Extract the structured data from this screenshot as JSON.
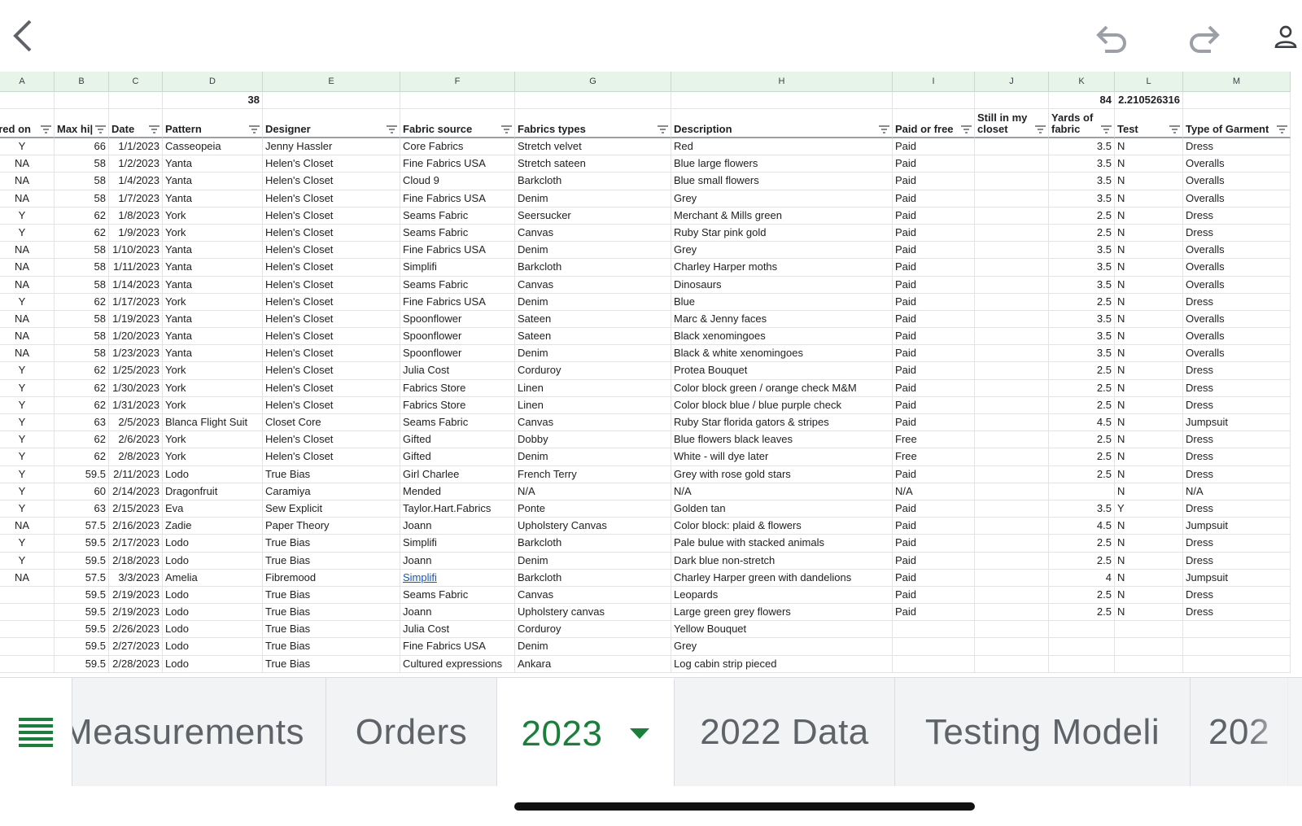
{
  "column_letters": [
    "A",
    "B",
    "C",
    "D",
    "E",
    "F",
    "G",
    "H",
    "I",
    "J",
    "K",
    "L",
    "M"
  ],
  "totals": {
    "D": "38",
    "K": "84",
    "L": "2.210526316"
  },
  "headers": [
    "ared on",
    "Max hi|",
    "Date",
    "Pattern",
    "Designer",
    "Fabric source",
    "Fabrics types",
    "Description",
    "Paid or free",
    "Still in my closet",
    "Yards of fabric",
    "Test",
    "Type of Garment"
  ],
  "rows": [
    [
      "Y",
      "66",
      "1/1/2023",
      "Casseopeia",
      "Jenny Hassler",
      "Core Fabrics",
      "Stretch velvet",
      "Red",
      "Paid",
      "",
      "3.5",
      "N",
      "Dress"
    ],
    [
      "NA",
      "58",
      "1/2/2023",
      "Yanta",
      "Helen's Closet",
      "Fine Fabrics USA",
      "Stretch sateen",
      "Blue large flowers",
      "Paid",
      "",
      "3.5",
      "N",
      "Overalls"
    ],
    [
      "NA",
      "58",
      "1/4/2023",
      "Yanta",
      "Helen's Closet",
      "Cloud 9",
      "Barkcloth",
      "Blue small flowers",
      "Paid",
      "",
      "3.5",
      "N",
      "Overalls"
    ],
    [
      "NA",
      "58",
      "1/7/2023",
      "Yanta",
      "Helen's Closet",
      "Fine Fabrics USA",
      "Denim",
      "Grey",
      "Paid",
      "",
      "3.5",
      "N",
      "Overalls"
    ],
    [
      "Y",
      "62",
      "1/8/2023",
      "York",
      "Helen's Closet",
      "Seams Fabric",
      "Seersucker",
      "Merchant & Mills green",
      "Paid",
      "",
      "2.5",
      "N",
      "Dress"
    ],
    [
      "Y",
      "62",
      "1/9/2023",
      "York",
      "Helen's Closet",
      "Seams Fabric",
      "Canvas",
      "Ruby Star pink gold",
      "Paid",
      "",
      "2.5",
      "N",
      "Dress"
    ],
    [
      "NA",
      "58",
      "1/10/2023",
      "Yanta",
      "Helen's Closet",
      "Fine Fabrics USA",
      "Denim",
      "Grey",
      "Paid",
      "",
      "3.5",
      "N",
      "Overalls"
    ],
    [
      "NA",
      "58",
      "1/11/2023",
      "Yanta",
      "Helen's Closet",
      "Simplifi",
      "Barkcloth",
      "Charley Harper moths",
      "Paid",
      "",
      "3.5",
      "N",
      "Overalls"
    ],
    [
      "NA",
      "58",
      "1/14/2023",
      "Yanta",
      "Helen's Closet",
      "Seams Fabric",
      "Canvas",
      "Dinosaurs",
      "Paid",
      "",
      "3.5",
      "N",
      "Overalls"
    ],
    [
      "Y",
      "62",
      "1/17/2023",
      "York",
      "Helen's Closet",
      "Fine Fabrics USA",
      "Denim",
      "Blue",
      "Paid",
      "",
      "2.5",
      "N",
      "Dress"
    ],
    [
      "NA",
      "58",
      "1/19/2023",
      "Yanta",
      "Helen's Closet",
      "Spoonflower",
      "Sateen",
      "Marc & Jenny faces",
      "Paid",
      "",
      "3.5",
      "N",
      "Overalls"
    ],
    [
      "NA",
      "58",
      "1/20/2023",
      "Yanta",
      "Helen's Closet",
      "Spoonflower",
      "Sateen",
      "Black xenomingoes",
      "Paid",
      "",
      "3.5",
      "N",
      "Overalls"
    ],
    [
      "NA",
      "58",
      "1/23/2023",
      "Yanta",
      "Helen's Closet",
      "Spoonflower",
      "Denim",
      "Black & white xenomingoes",
      "Paid",
      "",
      "3.5",
      "N",
      "Overalls"
    ],
    [
      "Y",
      "62",
      "1/25/2023",
      "York",
      "Helen's Closet",
      "Julia Cost",
      "Corduroy",
      "Protea Bouquet",
      "Paid",
      "",
      "2.5",
      "N",
      "Dress"
    ],
    [
      "Y",
      "62",
      "1/30/2023",
      "York",
      "Helen's Closet",
      "Fabrics Store",
      "Linen",
      "Color block green / orange check M&M",
      "Paid",
      "",
      "2.5",
      "N",
      "Dress"
    ],
    [
      "Y",
      "62",
      "1/31/2023",
      "York",
      "Helen's Closet",
      "Fabrics Store",
      "Linen",
      "Color block blue / blue purple check",
      "Paid",
      "",
      "2.5",
      "N",
      "Dress"
    ],
    [
      "Y",
      "63",
      "2/5/2023",
      "Blanca Flight Suit",
      "Closet Core",
      "Seams Fabric",
      "Canvas",
      "Ruby Star florida gators & stripes",
      "Paid",
      "",
      "4.5",
      "N",
      "Jumpsuit"
    ],
    [
      "Y",
      "62",
      "2/6/2023",
      "York",
      "Helen's Closet",
      "Gifted",
      "Dobby",
      "Blue flowers black leaves",
      "Free",
      "",
      "2.5",
      "N",
      "Dress"
    ],
    [
      "Y",
      "62",
      "2/8/2023",
      "York",
      "Helen's Closet",
      "Gifted",
      "Denim",
      "White - will dye later",
      "Free",
      "",
      "2.5",
      "N",
      "Dress"
    ],
    [
      "Y",
      "59.5",
      "2/11/2023",
      "Lodo",
      "True Bias",
      "Girl Charlee",
      "French Terry",
      "Grey with rose gold stars",
      "Paid",
      "",
      "2.5",
      "N",
      "Dress"
    ],
    [
      "Y",
      "60",
      "2/14/2023",
      "Dragonfruit",
      "Caramiya",
      "Mended",
      "N/A",
      "N/A",
      "N/A",
      "",
      "",
      "N",
      "N/A"
    ],
    [
      "Y",
      "63",
      "2/15/2023",
      "Eva",
      "Sew Explicit",
      "Taylor.Hart.Fabrics",
      "Ponte",
      "Golden tan",
      "Paid",
      "",
      "3.5",
      "Y",
      "Dress"
    ],
    [
      "NA",
      "57.5",
      "2/16/2023",
      "Zadie",
      "Paper Theory",
      "Joann",
      "Upholstery Canvas",
      "Color block: plaid & flowers",
      "Paid",
      "",
      "4.5",
      "N",
      "Jumpsuit"
    ],
    [
      "Y",
      "59.5",
      "2/17/2023",
      "Lodo",
      "True Bias",
      "Simplifi",
      "Barkcloth",
      "Pale bulue with stacked animals",
      "Paid",
      "",
      "2.5",
      "N",
      "Dress"
    ],
    [
      "Y",
      "59.5",
      "2/18/2023",
      "Lodo",
      "True Bias",
      "Joann",
      "Denim",
      "Dark blue non-stretch",
      "Paid",
      "",
      "2.5",
      "N",
      "Dress"
    ],
    [
      "NA",
      "57.5",
      "3/3/2023",
      "Amelia",
      "Fibremood",
      "Simplifi",
      "Barkcloth",
      "Charley Harper green with dandelions",
      "Paid",
      "",
      "4",
      "N",
      "Jumpsuit"
    ],
    [
      "",
      "59.5",
      "2/19/2023",
      "Lodo",
      "True Bias",
      "Seams Fabric",
      "Canvas",
      " Leopards",
      "Paid",
      "",
      "2.5",
      "N",
      "Dress"
    ],
    [
      "",
      "59.5",
      "2/19/2023",
      "Lodo",
      "True Bias",
      "Joann",
      "Upholstery canvas",
      "Large green grey flowers",
      "Paid",
      "",
      "2.5",
      "N",
      "Dress"
    ],
    [
      "",
      "59.5",
      "2/26/2023",
      "Lodo",
      "True Bias",
      "Julia Cost",
      "Corduroy",
      "Yellow Bouquet",
      "",
      "",
      "",
      "",
      ""
    ],
    [
      "",
      "59.5",
      "2/27/2023",
      "Lodo",
      "True Bias",
      "Fine Fabrics USA",
      "Denim",
      "Grey",
      "",
      "",
      "",
      "",
      ""
    ],
    [
      "",
      "59.5",
      "2/28/2023",
      "Lodo",
      "True Bias",
      "Cultured expressions",
      "Ankara",
      "Log cabin strip pieced",
      "",
      "",
      "",
      "",
      ""
    ]
  ],
  "link_cell": {
    "row": 25,
    "col": 5
  },
  "tabs": [
    {
      "label": "Measurements",
      "active": false
    },
    {
      "label": "Orders",
      "active": false
    },
    {
      "label": "2023",
      "active": true
    },
    {
      "label": "2022 Data",
      "active": false
    },
    {
      "label": "Testing Modeli",
      "active": false
    },
    {
      "label": "202",
      "active": false
    }
  ],
  "icons": {
    "back": "chevron-left-icon",
    "undo": "undo-icon",
    "redo": "redo-icon",
    "account": "account-icon",
    "sheets_menu": "all-sheets-icon"
  },
  "colors": {
    "accent": "#188038",
    "header_bg": "#e6f4ea",
    "link": "#1155cc"
  }
}
